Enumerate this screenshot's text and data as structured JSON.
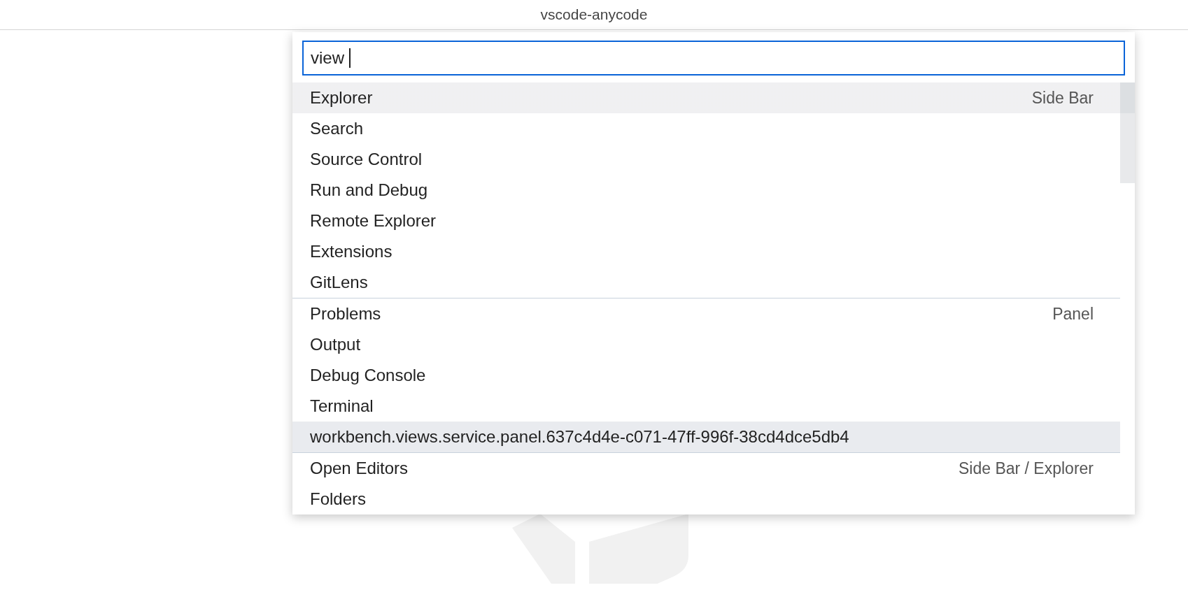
{
  "window": {
    "title": "vscode-anycode"
  },
  "quick_pick": {
    "input": {
      "value": "view "
    },
    "groups": [
      {
        "label": "Side Bar",
        "items": [
          {
            "text": "Explorer",
            "selected": true,
            "hovered": false
          },
          {
            "text": "Search",
            "selected": false,
            "hovered": false
          },
          {
            "text": "Source Control",
            "selected": false,
            "hovered": false
          },
          {
            "text": "Run and Debug",
            "selected": false,
            "hovered": false
          },
          {
            "text": "Remote Explorer",
            "selected": false,
            "hovered": false
          },
          {
            "text": "Extensions",
            "selected": false,
            "hovered": false
          },
          {
            "text": "GitLens",
            "selected": false,
            "hovered": false
          }
        ]
      },
      {
        "label": "Panel",
        "items": [
          {
            "text": "Problems",
            "selected": false,
            "hovered": false
          },
          {
            "text": "Output",
            "selected": false,
            "hovered": false
          },
          {
            "text": "Debug Console",
            "selected": false,
            "hovered": false
          },
          {
            "text": "Terminal",
            "selected": false,
            "hovered": false
          },
          {
            "text": "workbench.views.service.panel.637c4d4e-c071-47ff-996f-38cd4dce5db4",
            "selected": false,
            "hovered": true
          }
        ]
      },
      {
        "label": "Side Bar / Explorer",
        "items": [
          {
            "text": "Open Editors",
            "selected": false,
            "hovered": false
          },
          {
            "text": "Folders",
            "selected": false,
            "hovered": false
          }
        ]
      }
    ]
  }
}
